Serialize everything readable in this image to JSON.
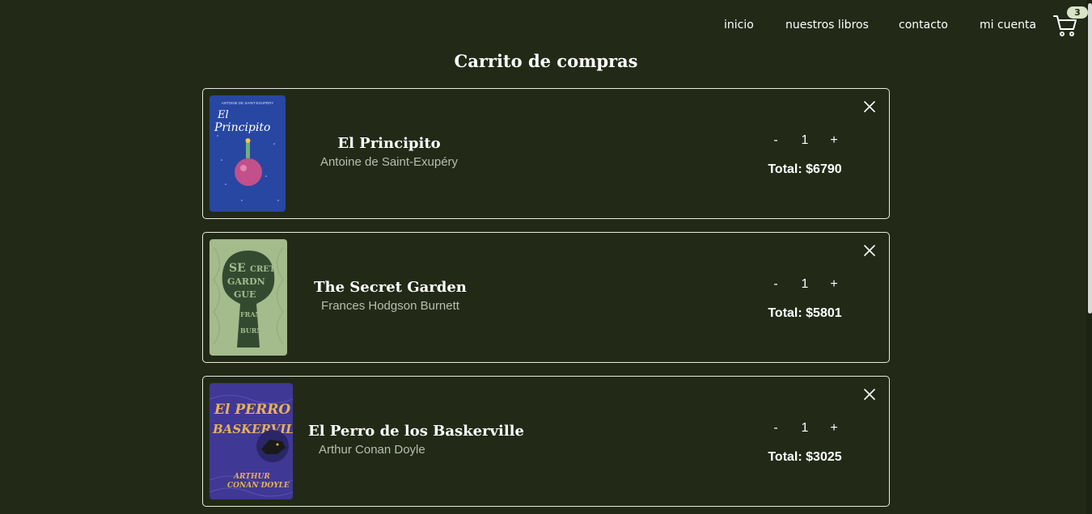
{
  "nav": {
    "links": [
      "inicio",
      "nuestros libros",
      "contacto",
      "mi cuenta"
    ],
    "cart_count": "3",
    "cart_icon": "cart-icon"
  },
  "page_title": "Carrito de compras",
  "items": [
    {
      "title": "El Principito",
      "author": "Antoine de Saint-Exupéry",
      "quantity": "1",
      "minus": "-",
      "plus": "+",
      "total": "Total: $6790",
      "cover_text": "El Principito",
      "cover_top": "ANTOINE DE SAINT-EXUPÉRY"
    },
    {
      "title": "The Secret Garden",
      "author": "Frances Hodgson Burnett",
      "quantity": "1",
      "minus": "-",
      "plus": "+",
      "total": "Total: $5801"
    },
    {
      "title": "El Perro de los Baskerville",
      "author": "Arthur Conan Doyle",
      "quantity": "1",
      "minus": "-",
      "plus": "+",
      "total": "Total: $3025"
    }
  ],
  "colors": {
    "background": "#222a17",
    "border": "#e8ecdf",
    "badge": "#d9e3c6",
    "author_text": "#b8bdb0"
  }
}
